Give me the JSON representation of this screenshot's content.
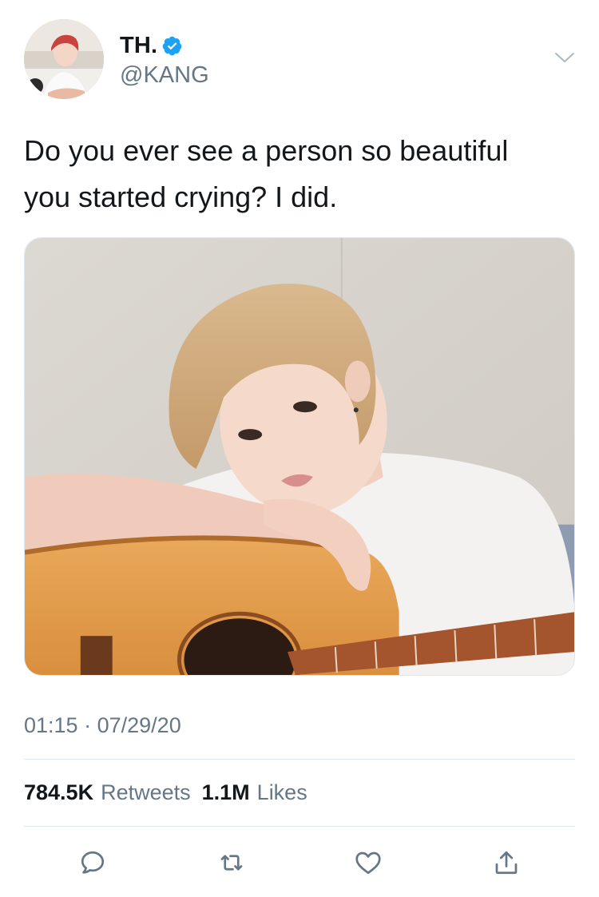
{
  "tweet": {
    "author": {
      "display_name": "TH.",
      "handle": "@KANG",
      "verified": true
    },
    "text_line1": "Do you ever see a person so beautiful",
    "text_line2": "you started crying? I did.",
    "time": "01:15",
    "separator": "·",
    "date": "07/29/20",
    "stats": {
      "retweets_count": "784.5K",
      "retweets_label": "Retweets",
      "likes_count": "1.1M",
      "likes_label": "Likes"
    }
  },
  "icons": {
    "more": "chevron-down-icon",
    "verified": "verified-badge-icon",
    "reply": "reply-icon",
    "retweet": "retweet-icon",
    "like": "heart-icon",
    "share": "share-icon"
  },
  "colors": {
    "text_primary": "#14171a",
    "text_secondary": "#657786",
    "verified_blue": "#1da1f2",
    "divider": "#e1e8ed"
  }
}
